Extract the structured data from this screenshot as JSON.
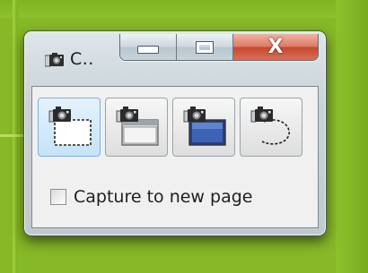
{
  "window": {
    "title": "C..",
    "caption_buttons": {
      "minimize_icon": "minimize-icon",
      "maximize_icon": "maximize-icon",
      "close_icon": "close-icon",
      "close_glyph": "X"
    }
  },
  "toolbar": {
    "buttons": [
      {
        "icon": "capture-region-icon",
        "active": true
      },
      {
        "icon": "capture-window-icon",
        "active": false
      },
      {
        "icon": "capture-fullscreen-icon",
        "active": false
      },
      {
        "icon": "capture-freeform-icon",
        "active": false
      }
    ]
  },
  "options": {
    "capture_new_page_label": "Capture to new page",
    "capture_new_page_checked": false
  },
  "colors": {
    "background": "#86b827",
    "close_button": "#c8482f",
    "active_button": "#c6e3f8"
  }
}
